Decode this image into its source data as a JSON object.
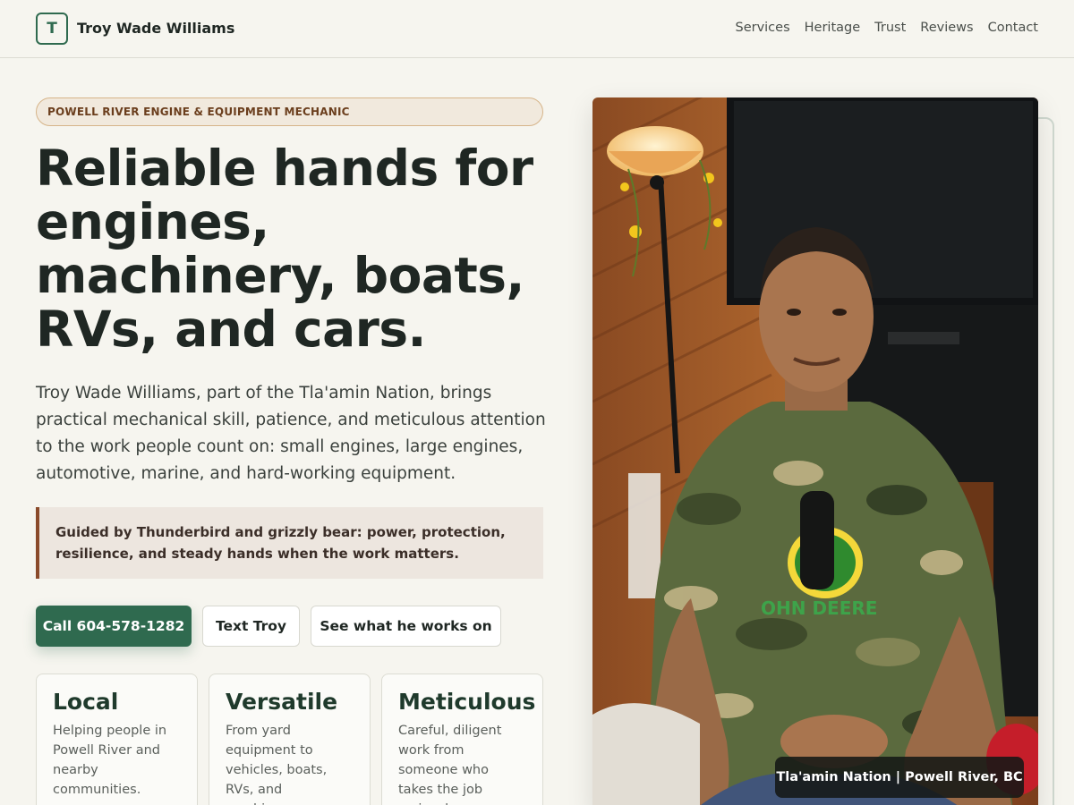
{
  "header": {
    "logo_letter": "T",
    "brand_name": "Troy Wade Williams",
    "nav": [
      "Services",
      "Heritage",
      "Trust",
      "Reviews",
      "Contact"
    ]
  },
  "hero": {
    "eyebrow": "POWELL RIVER ENGINE & EQUIPMENT MECHANIC",
    "headline": "Reliable hands for engines, machinery, boats, RVs, and cars.",
    "lede": "Troy Wade Williams, part of the Tla'amin Nation, brings practical mechanical skill, patience, and meticulous attention to the work people count on: small engines, large engines, automotive, marine, and hard-working equipment.",
    "quote": "Guided by Thunderbird and grizzly bear: power, protection, resilience, and steady hands when the work matters.",
    "buttons": {
      "call": "Call 604-578-1282",
      "text": "Text Troy",
      "see": "See what he works on"
    }
  },
  "cards": [
    {
      "title": "Local",
      "body": "Helping people in Powell River and nearby communities."
    },
    {
      "title": "Versatile",
      "body": "From yard equipment to vehicles, boats, RVs, and machinery."
    },
    {
      "title": "Meticulous",
      "body": "Careful, diligent work from someone who takes the job seriously."
    }
  ],
  "photo": {
    "caption": "Tla'amin Nation | Powell River, BC",
    "shirt_text": "OHN DEERE"
  },
  "colors": {
    "accent": "#2f6a4f",
    "background": "#f6f5ef",
    "quote_border": "#8a4a2a",
    "eyebrow_text": "#6b3e1d"
  }
}
